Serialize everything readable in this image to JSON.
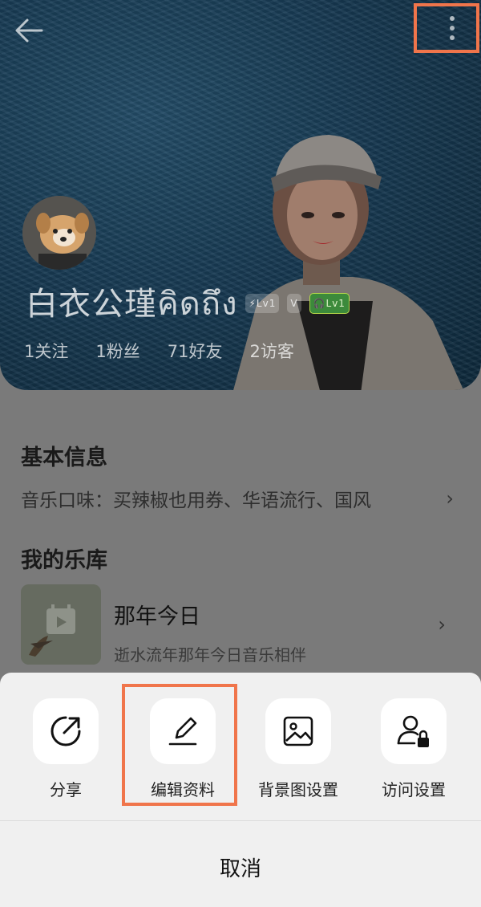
{
  "profile": {
    "username": "白衣公瑾คิดถึง",
    "badges": [
      "Lv1",
      "Lv1"
    ],
    "stats": [
      {
        "label": "1关注"
      },
      {
        "label": "1粉丝"
      },
      {
        "label": "71好友"
      },
      {
        "label": "2访客"
      }
    ]
  },
  "basic_info": {
    "title": "基本信息",
    "music_taste": "音乐口味：买辣椒也用券、华语流行、国风"
  },
  "library": {
    "title": "我的乐库",
    "item": {
      "title": "那年今日",
      "subtitle": "逝水流年那年今日音乐相伴"
    }
  },
  "sheet": {
    "actions": [
      {
        "label": "分享",
        "icon": "share-icon"
      },
      {
        "label": "编辑资料",
        "icon": "edit-icon"
      },
      {
        "label": "背景图设置",
        "icon": "image-icon"
      },
      {
        "label": "访问设置",
        "icon": "user-lock-icon"
      }
    ],
    "cancel_label": "取消"
  },
  "colors": {
    "highlight": "#f0754b",
    "sheet_bg": "#f0f0f0",
    "overlay": "#7a7a7a"
  }
}
